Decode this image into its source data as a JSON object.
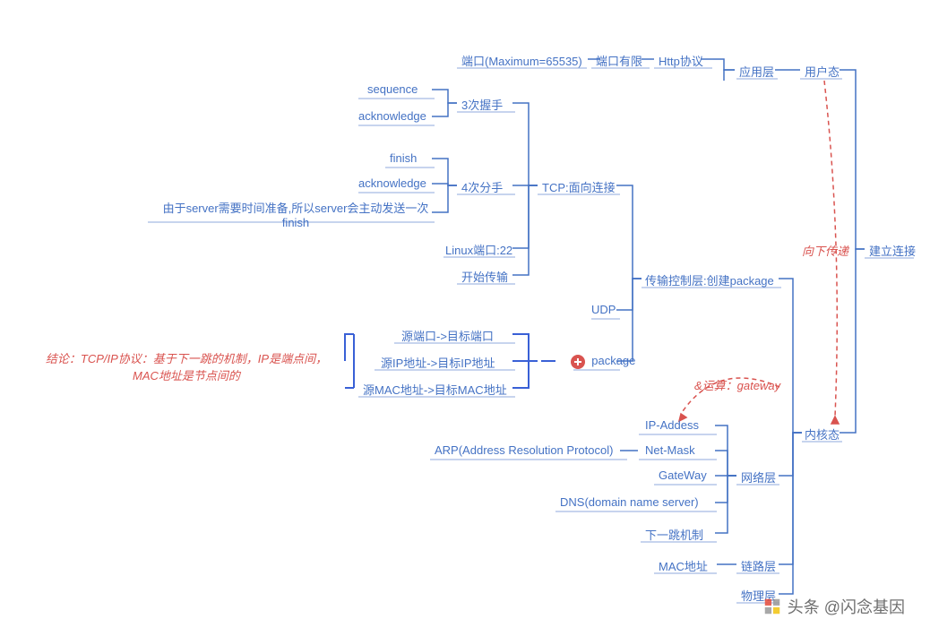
{
  "root": "建立连接",
  "layer_user": {
    "label": "用户态"
  },
  "layer_app": {
    "label": "应用层",
    "children": {
      "http": "Http协议",
      "port_limit": "端口有限",
      "port_max": "端口(Maximum=65535)"
    }
  },
  "layer_kernel": {
    "label": "内核态"
  },
  "layer_transport": {
    "label": "传输控制层:创建package",
    "tcp": {
      "label": "TCP:面向连接",
      "handshake": {
        "label": "3次握手",
        "items": [
          "sequence",
          "acknowledge"
        ]
      },
      "finhand": {
        "label": "4次分手",
        "items": [
          "finish",
          "acknowledge",
          "由于server需要时间准备,所以server会主动发送一次finish"
        ]
      },
      "linux_port": "Linux端口:22",
      "start_tx": "开始传输"
    },
    "udp": "UDP",
    "package": {
      "label": "package",
      "items": [
        "源端口->目标端口",
        "源IP地址->目标IP地址",
        "源MAC地址->目标MAC地址"
      ]
    }
  },
  "layer_network": {
    "label": "网络层",
    "items": {
      "ip": "IP-Addess",
      "netmask": {
        "label": "Net-Mask",
        "child": "ARP(Address Resolution Protocol)"
      },
      "gateway": "GateWay",
      "dns": "DNS(domain name server)",
      "nexthop": "下一跳机制"
    }
  },
  "layer_link": {
    "label": "链路层",
    "mac": "MAC地址"
  },
  "layer_phys": {
    "label": "物理层"
  },
  "annotations": {
    "down_pass": "向下传递",
    "gateway_op": "&运算：gateway",
    "conclusion": "结论：TCP/IP协议：基于下一跳的机制，IP是端点间，MAC地址是节点间的"
  },
  "watermark": "头条 @闪念基因"
}
